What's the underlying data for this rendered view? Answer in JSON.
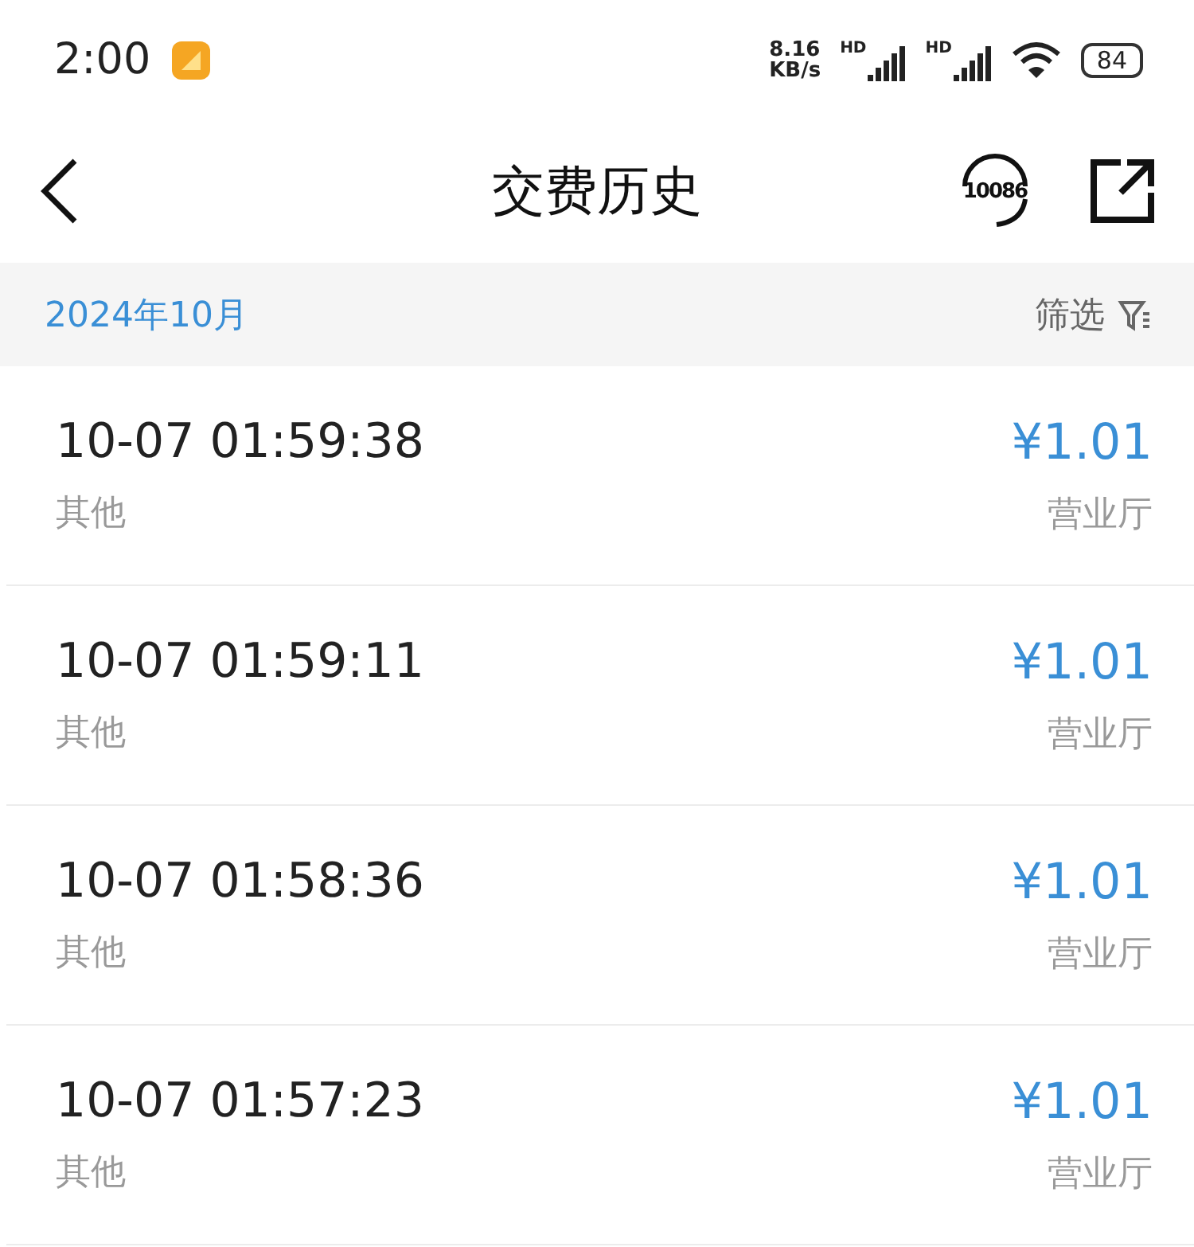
{
  "status_bar": {
    "time": "2:00",
    "speed_value": "8.16",
    "speed_unit": "KB/s",
    "signals": [
      "HD",
      "HD"
    ],
    "battery": "84"
  },
  "header": {
    "title": "交费历史",
    "hotline": "10086"
  },
  "filter_bar": {
    "month": "2024年10月",
    "filter": "筛选"
  },
  "records": [
    {
      "time": "10-07 01:59:38",
      "type": "其他",
      "amount": "¥1.01",
      "channel": "营业厅"
    },
    {
      "time": "10-07 01:59:11",
      "type": "其他",
      "amount": "¥1.01",
      "channel": "营业厅"
    },
    {
      "time": "10-07 01:58:36",
      "type": "其他",
      "amount": "¥1.01",
      "channel": "营业厅"
    },
    {
      "time": "10-07 01:57:23",
      "type": "其他",
      "amount": "¥1.01",
      "channel": "营业厅"
    }
  ]
}
